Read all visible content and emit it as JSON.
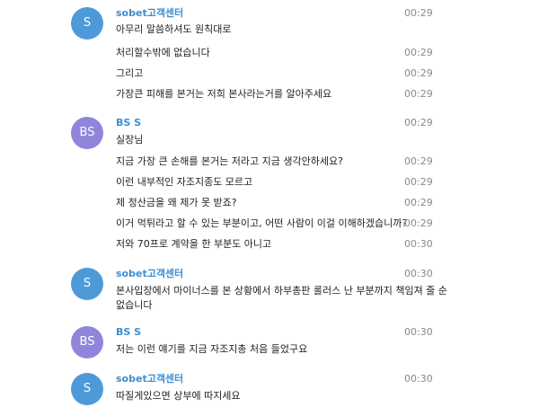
{
  "colors": {
    "sobet_avatar": "#4e9ad9",
    "bs_avatar": "#8f86db",
    "name_text": "#3e8ed0",
    "time_text": "#8a8a8a"
  },
  "groups": [
    {
      "sender": "sobet고객센터",
      "avatar": "S",
      "time": "00:29",
      "messages": [
        {
          "text": "아무리 말씀하셔도 원칙대로",
          "time": ""
        },
        {
          "text": "처리할수밖에 없습니다",
          "time": "00:29"
        },
        {
          "text": "그리고",
          "time": "00:29"
        },
        {
          "text": "가장큰 피해를 본거는 저희 본사라는거를 알아주세요",
          "time": "00:29"
        }
      ]
    },
    {
      "sender": "BS S",
      "avatar": "BS",
      "time": "00:29",
      "messages": [
        {
          "text": "실장님",
          "time": ""
        },
        {
          "text": "지금 가장 큰 손해를 본거는 저라고 지금 생각안하세요?",
          "time": "00:29"
        },
        {
          "text": "이런 내부적인 자조지종도 모르고",
          "time": "00:29"
        },
        {
          "text": "제 정산금을 왜 제가 못 받죠?",
          "time": "00:29"
        },
        {
          "text": "이거 먹튀라고 할 수 있는 부분이고, 어떤 사람이 이걸 이해하겠습니까?",
          "time": "00:29"
        },
        {
          "text": "저와 70프로 계약을 한 부분도 아니고",
          "time": "00:30"
        }
      ]
    },
    {
      "sender": "sobet고객센터",
      "avatar": "S",
      "time": "00:30",
      "messages": [
        {
          "text": "본사입장에서 마이너스를 본 상황에서 하부총판 롤러스 난 부분까지 책임져 줄 순 없습니다",
          "time": ""
        }
      ]
    },
    {
      "sender": "BS S",
      "avatar": "BS",
      "time": "00:30",
      "messages": [
        {
          "text": "저는 이런 얘기를 지금 자조지총 처음 들었구요",
          "time": ""
        }
      ]
    },
    {
      "sender": "sobet고객센터",
      "avatar": "S",
      "time": "00:30",
      "messages": [
        {
          "text": "따질게있으면 상부에 따지세요",
          "time": ""
        }
      ]
    }
  ]
}
